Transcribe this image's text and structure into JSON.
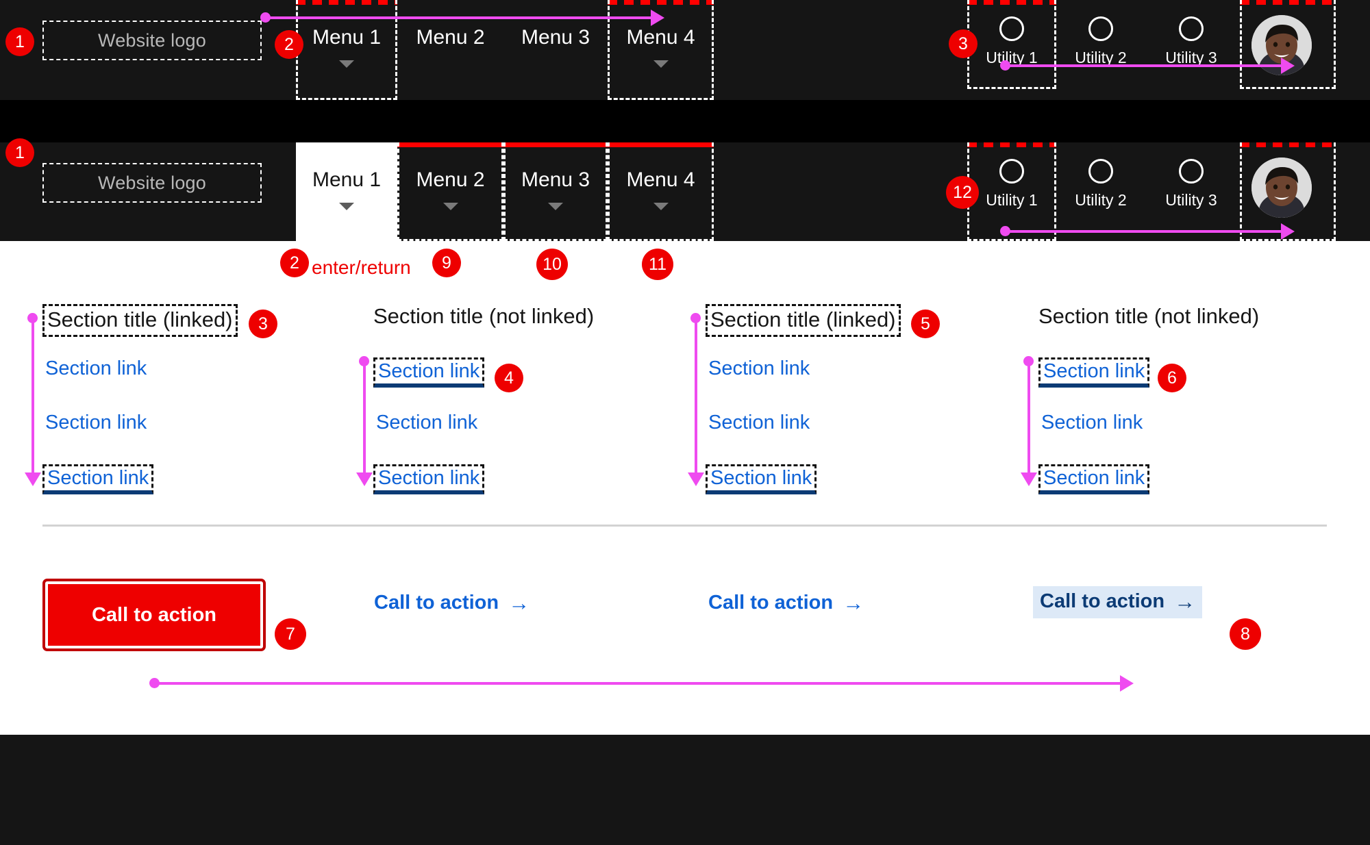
{
  "colors": {
    "nav_background": "#151515",
    "band_background": "#000000",
    "panel_background": "#ffffff",
    "badge_red": "#ee0000",
    "focus_red_underline": "#ff0000",
    "focus_outline_white": "#ffffff",
    "focus_outline_black": "#111111",
    "link_blue": "#0f62d6",
    "link_underline_navy": "#0c3b75",
    "cta_highlight_bg": "#dde9f7",
    "arrow_magenta": "#ef4bf0",
    "divider_grey": "#d2d2d2"
  },
  "nav_top": {
    "logo_label": "Website logo",
    "menu_items": [
      {
        "label": "Menu 1",
        "has_caret": true,
        "focused": true,
        "active": false
      },
      {
        "label": "Menu 2",
        "has_caret": true,
        "focused": false,
        "active": false
      },
      {
        "label": "Menu 3",
        "has_caret": true,
        "focused": false,
        "active": false
      },
      {
        "label": "Menu 4",
        "has_caret": true,
        "focused": true,
        "active": false
      }
    ],
    "utilities": [
      {
        "label": "Utility 1",
        "icon": "circle-icon",
        "focused": true
      },
      {
        "label": "Utility 2",
        "icon": "circle-icon",
        "focused": false
      },
      {
        "label": "Utility 3",
        "icon": "circle-icon",
        "focused": false
      }
    ],
    "avatar": {
      "icon": "user-avatar-photo",
      "focused": true
    },
    "badges": [
      {
        "number": "1",
        "target": "logo"
      },
      {
        "number": "2",
        "target": "menu-1"
      },
      {
        "number": "3",
        "target": "utility-1"
      }
    ]
  },
  "nav_bottom": {
    "logo_label": "Website logo",
    "menu_items": [
      {
        "label": "Menu 1",
        "has_caret": true,
        "focused": false,
        "active": true
      },
      {
        "label": "Menu 2",
        "has_caret": true,
        "focused": true,
        "active": false
      },
      {
        "label": "Menu 3",
        "has_caret": true,
        "focused": true,
        "active": false
      },
      {
        "label": "Menu 4",
        "has_caret": true,
        "focused": true,
        "active": false
      }
    ],
    "utilities": [
      {
        "label": "Utility 1",
        "icon": "circle-icon",
        "focused": true
      },
      {
        "label": "Utility 2",
        "icon": "circle-icon",
        "focused": false
      },
      {
        "label": "Utility 3",
        "icon": "circle-icon",
        "focused": false
      }
    ],
    "avatar": {
      "icon": "user-avatar-photo",
      "focused": true
    },
    "badges": [
      {
        "number": "1",
        "target": "logo"
      },
      {
        "number": "12",
        "target": "utility-1"
      }
    ]
  },
  "key_hints": [
    {
      "badge": "2",
      "text": "enter/return"
    },
    {
      "badge": "9",
      "text": ""
    },
    {
      "badge": "10",
      "text": ""
    },
    {
      "badge": "11",
      "text": ""
    }
  ],
  "dropdown": {
    "columns": [
      {
        "title": "Section title (linked)",
        "title_linked": true,
        "title_focused": true,
        "badge": "3",
        "links": [
          {
            "label": "Section link",
            "focused": false
          },
          {
            "label": "Section link",
            "focused": false
          },
          {
            "label": "Section link",
            "focused": true
          }
        ],
        "link_badge": null
      },
      {
        "title": "Section title (not linked)",
        "title_linked": false,
        "title_focused": false,
        "badge": null,
        "links": [
          {
            "label": "Section link",
            "focused": true
          },
          {
            "label": "Section link",
            "focused": false
          },
          {
            "label": "Section link",
            "focused": true
          }
        ],
        "link_badge": "4"
      },
      {
        "title": "Section title (linked)",
        "title_linked": true,
        "title_focused": true,
        "badge": "5",
        "links": [
          {
            "label": "Section link",
            "focused": false
          },
          {
            "label": "Section link",
            "focused": false
          },
          {
            "label": "Section link",
            "focused": true
          }
        ],
        "link_badge": null
      },
      {
        "title": "Section title (not linked)",
        "title_linked": false,
        "title_focused": false,
        "badge": null,
        "links": [
          {
            "label": "Section link",
            "focused": true
          },
          {
            "label": "Section link",
            "focused": false
          },
          {
            "label": "Section link",
            "focused": true
          }
        ],
        "link_badge": "6"
      }
    ],
    "ctas": [
      {
        "label": "Call to action",
        "style": "primary-button",
        "arrow": "",
        "badge": "7"
      },
      {
        "label": "Call to action",
        "style": "text-link",
        "arrow": "→",
        "badge": null
      },
      {
        "label": "Call to action",
        "style": "text-link",
        "arrow": "→",
        "badge": null
      },
      {
        "label": "Call to action",
        "style": "text-link-highlighted",
        "arrow": "→",
        "badge": "8"
      }
    ]
  }
}
